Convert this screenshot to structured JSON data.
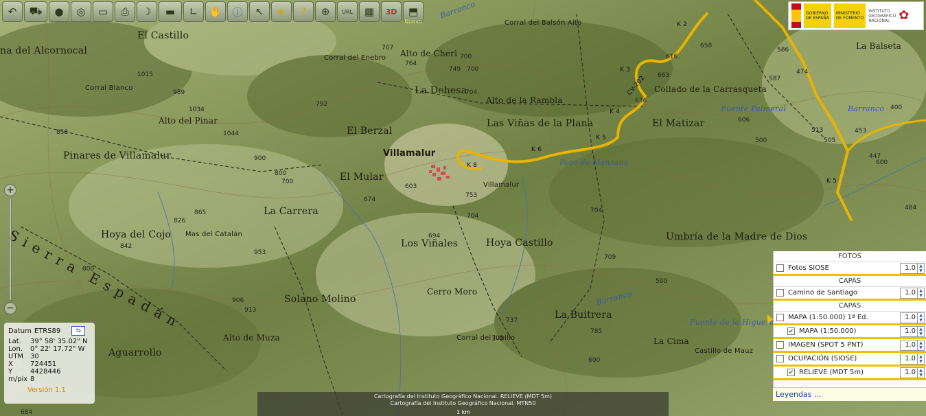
{
  "toolbar": {
    "icons": [
      "back-arrow-icon",
      "car-icon",
      "globe-icon",
      "cd-icon",
      "screen-icon",
      "print-icon",
      "banana-icon",
      "ruler-icon",
      "angle-icon",
      "hand-icon",
      "info-icon",
      "cursor-icon",
      "star-icon",
      "help-icon",
      "gps-icon",
      "url-icon",
      "photo-icon",
      "3d-icon",
      "new-layer-icon"
    ],
    "labels": {
      "url": "URL",
      "three_d": "3D",
      "new": "Nuevo"
    }
  },
  "logo": {
    "gov_line1": "GOBIERNO",
    "gov_line2": "DE ESPAÑA",
    "min_line1": "MINISTERIO",
    "min_line2": "DE FOMENTO",
    "ign_line1": "INSTITUTO",
    "ign_line2": "GEOGRÁFICO",
    "ign_line3": "NACIONAL"
  },
  "map": {
    "places": [
      {
        "t": "El Castillo",
        "c": "big"
      },
      {
        "t": "na del Alcornocal",
        "c": "big"
      },
      {
        "t": "Corral del Balsón Alto",
        "c": "sm"
      },
      {
        "t": "Alto de Cheri",
        "c": "med"
      },
      {
        "t": "Corral del Enebro",
        "c": "sm"
      },
      {
        "t": "Corral Blanco",
        "c": "sm"
      },
      {
        "t": "La Dehesa",
        "c": "big"
      },
      {
        "t": "Alto de la Rambla",
        "c": "med"
      },
      {
        "t": "Collado de la Carrasqueta",
        "c": "med"
      },
      {
        "t": "La Balseta",
        "c": "med"
      },
      {
        "t": "Alto del Pinar",
        "c": "med"
      },
      {
        "t": "El Berzal",
        "c": "big"
      },
      {
        "t": "Las Viñas de la Plana",
        "c": "big"
      },
      {
        "t": "El Matizar",
        "c": "big"
      },
      {
        "t": "Pinares de Villamalur",
        "c": "big"
      },
      {
        "t": "Villamalur",
        "c": "town"
      },
      {
        "t": "El Mular",
        "c": "big"
      },
      {
        "t": "Villamalur",
        "c": "sm"
      },
      {
        "t": "La Carrera",
        "c": "big"
      },
      {
        "t": "Hoya del Cojo",
        "c": "big"
      },
      {
        "t": "Mas del Catalán",
        "c": "sm"
      },
      {
        "t": "Los Viñales",
        "c": "big"
      },
      {
        "t": "Hoya Castillo",
        "c": "big"
      },
      {
        "t": "Umbría de la Madre de Dios",
        "c": "big"
      },
      {
        "t": "Cerro Moro",
        "c": "med"
      },
      {
        "t": "Solano Molino",
        "c": "big"
      },
      {
        "t": "La Buitrera",
        "c": "big"
      },
      {
        "t": "Alto de Muza",
        "c": "med"
      },
      {
        "t": "Aguarrollo",
        "c": "big"
      },
      {
        "t": "Corral del Jupillo",
        "c": "sm"
      },
      {
        "t": "La Cima",
        "c": "med"
      },
      {
        "t": "Castillo de Mauz",
        "c": "sm"
      },
      {
        "t": "Sierra Espadán",
        "c": "spaced"
      }
    ],
    "water": [
      "Fuente Palmeral",
      "Barranco",
      "Pozo de Manzana",
      "Fuente de la Higuera",
      "Barranco",
      "Barranco"
    ],
    "roads": [
      "K 3",
      "K 2",
      "CV-202",
      "K 4",
      "K 5",
      "K 6",
      "K 8",
      "K 5"
    ],
    "elevations": [
      "700",
      "707",
      "764",
      "749",
      "704",
      "792",
      "616",
      "663",
      "636",
      "586",
      "658",
      "587",
      "474",
      "1015",
      "989",
      "1034",
      "858",
      "1044",
      "900",
      "800",
      "700",
      "674",
      "603",
      "753",
      "694",
      "704",
      "700",
      "842",
      "826",
      "865",
      "953",
      "913",
      "906",
      "800",
      "705",
      "737",
      "785",
      "704",
      "600",
      "709",
      "500",
      "447",
      "453",
      "400",
      "600",
      "513",
      "606",
      "500",
      "505",
      "484",
      "684"
    ]
  },
  "zoom": {
    "plus": "+",
    "minus": "−"
  },
  "coords": {
    "datum_label": "Datum",
    "datum_value": "ETRS89",
    "rows": [
      {
        "k": "Lat.",
        "v": "39° 58' 35.02\" N"
      },
      {
        "k": "Lon.",
        "v": "0° 22' 17.72\" W"
      },
      {
        "k": "UTM",
        "v": "30"
      },
      {
        "k": "X",
        "v": "724451"
      },
      {
        "k": "Y",
        "v": "4428446"
      },
      {
        "k": "m/pix",
        "v": "8"
      }
    ],
    "version": "Versión 1.1"
  },
  "credits": {
    "line1": "Cartografía del Instituto Geográfico Nacional. RELIEVE (MDT 5m)",
    "line2": "Cartografía del Instituto Geográfico Nacional. MTN50",
    "scale": "1 km"
  },
  "layers": {
    "sections": [
      "FOTOS",
      "CAPAS",
      "CAPAS"
    ],
    "items": [
      {
        "name": "Fotos SIOSE",
        "checked": false,
        "opacity": "1.0"
      },
      {
        "name": "Camino de Santiago",
        "checked": false,
        "opacity": "1.0"
      },
      {
        "name": "MAPA (1:50.000) 1ª Ed.",
        "checked": false,
        "opacity": "1.0"
      },
      {
        "name": "MAPA (1:50.000)",
        "checked": true,
        "opacity": "1.0"
      },
      {
        "name": "IMAGEN (SPOT 5 PNT)",
        "checked": false,
        "opacity": "1.0"
      },
      {
        "name": "OCUPACIÓN (SIOSE)",
        "checked": false,
        "opacity": "1.0"
      },
      {
        "name": "RELIEVE (MDT 5m)",
        "checked": true,
        "opacity": "1.0"
      }
    ],
    "legend": "Leyendas ..."
  },
  "colors": {
    "accent": "#e6c200",
    "road": "#e8b400",
    "water": "#3c5aa0",
    "terrain": "#8a9a60"
  }
}
